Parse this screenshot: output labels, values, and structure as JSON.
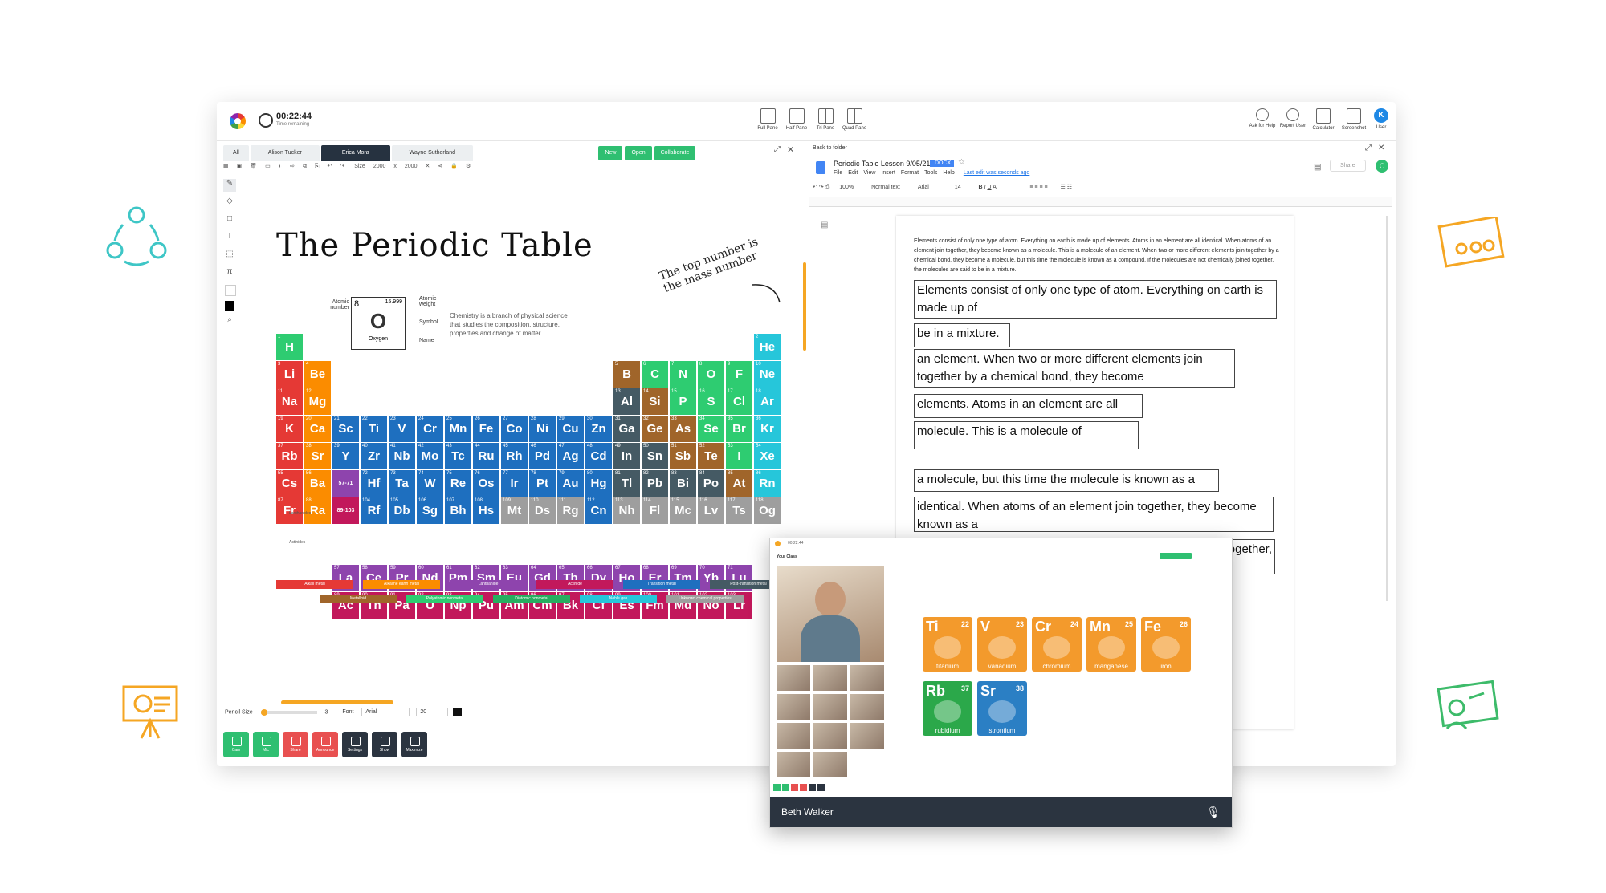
{
  "header": {
    "timer": "00:22:44",
    "timer_sub": "Time remaining",
    "panes": [
      "Full Pane",
      "Half Pane",
      "Tri Pane",
      "Quad Pane"
    ],
    "tools": [
      "Ask for Help",
      "Report User",
      "Calculator",
      "Screenshot"
    ],
    "user_initial": "K",
    "user_label": "User"
  },
  "tabs": [
    "All",
    "Alison Tucker",
    "Erica Mora",
    "Wayne Sutherland"
  ],
  "actions": {
    "new": "New",
    "open": "Open",
    "collaborate": "Collaborate"
  },
  "toolbar": {
    "size_label": "Size",
    "width": "2000",
    "x": "x",
    "height": "2000"
  },
  "whiteboard": {
    "title": "The Periodic Table",
    "note": "The top number is the mass number",
    "description": "Chemistry is a branch of physical science that studies the composition, structure, properties and change of matter",
    "key": {
      "number": "8",
      "weight": "15.999",
      "symbol": "O",
      "name": "Oxygen",
      "labels": [
        "Atomic number",
        "Atomic weight",
        "Symbol",
        "Name"
      ]
    },
    "lanthanides_label": "Lanthanides",
    "actinides_label": "Actinides"
  },
  "footer": {
    "pencil_label": "Pencil Size",
    "pencil_value": "3",
    "font_label": "Font",
    "font_value": "Arial",
    "font_size": "20",
    "buttons": [
      "Cam",
      "Mic",
      "Share",
      "Announce",
      "Settings",
      "Show",
      "Maximize"
    ]
  },
  "doc": {
    "back": "Back to folder",
    "title": "Periodic Table Lesson 9/05/21",
    "badge": ".DOCX",
    "menu": [
      "File",
      "Edit",
      "View",
      "Insert",
      "Format",
      "Tools",
      "Help"
    ],
    "last_edit": "Last edit was seconds ago",
    "share": "Share",
    "zoom": "100%",
    "style": "Normal text",
    "font": "Arial",
    "font_size": "14",
    "paragraph": "Elements consist of only one type of atom. Everything on earth is made up of elements. Atoms in an element are all identical. When atoms of an element join together, they become known as a molecule. This is a molecule of an element. When two or more different elements join together by a chemical bond, they become a molecule, but this time the molecule is known as a compound. If the molecules are not chemically joined together, the molecules are said to be in a mixture.",
    "strips": [
      "Elements consist of only one type of atom. Everything on earth is made up of",
      "be in a mixture.",
      "an element. When two or more different elements join together by a chemical bond, they become",
      "elements. Atoms in an element are all",
      "molecule. This is a molecule of",
      "a molecule, but this time the molecule is known as a",
      "identical. When atoms of an element join together, they become known as a",
      "together,"
    ]
  },
  "popup": {
    "name": "Beth Walker",
    "class_label": "Your Class",
    "tiles": [
      {
        "s": "Ti",
        "n": "22",
        "name": "titanium",
        "color": "#f39a2c"
      },
      {
        "s": "V",
        "n": "23",
        "name": "vanadium",
        "color": "#f39a2c"
      },
      {
        "s": "Cr",
        "n": "24",
        "name": "chromium",
        "color": "#f39a2c"
      },
      {
        "s": "Mn",
        "n": "25",
        "name": "manganese",
        "color": "#f39a2c"
      },
      {
        "s": "Fe",
        "n": "26",
        "name": "iron",
        "color": "#f39a2c"
      },
      {
        "s": "Rb",
        "n": "37",
        "name": "rubidium",
        "color": "#2ba84a"
      },
      {
        "s": "Sr",
        "n": "38",
        "name": "strontium",
        "color": "#2b7fc4"
      }
    ]
  },
  "legend": [
    {
      "label": "Alkali metal",
      "color": "#e53935"
    },
    {
      "label": "Alkaline earth metal",
      "color": "#fb8c00"
    },
    {
      "label": "Lanthanide",
      "color": "#8e44ad"
    },
    {
      "label": "Actinide",
      "color": "#c2185b"
    },
    {
      "label": "Transition metal",
      "color": "#1e6fbf"
    },
    {
      "label": "Post-transition metal",
      "color": "#455a64"
    },
    {
      "label": "Metalloid",
      "color": "#a0652a"
    },
    {
      "label": "Polyatomic nonmetal",
      "color": "#2ecc71"
    },
    {
      "label": "Diatomic nonmetal",
      "color": "#27ae60"
    },
    {
      "label": "Noble gas",
      "color": "#26c6da"
    },
    {
      "label": "Unknown chemical properties",
      "color": "#9e9e9e"
    }
  ],
  "elements": [
    {
      "s": "H",
      "n": 1,
      "r": 0,
      "c": 0,
      "g": "nm"
    },
    {
      "s": "He",
      "n": 2,
      "r": 0,
      "c": 17,
      "g": "ng"
    },
    {
      "s": "Li",
      "n": 3,
      "r": 1,
      "c": 0,
      "g": "am"
    },
    {
      "s": "Be",
      "n": 4,
      "r": 1,
      "c": 1,
      "g": "ae"
    },
    {
      "s": "B",
      "n": 5,
      "r": 1,
      "c": 12,
      "g": "ml"
    },
    {
      "s": "C",
      "n": 6,
      "r": 1,
      "c": 13,
      "g": "nm"
    },
    {
      "s": "N",
      "n": 7,
      "r": 1,
      "c": 14,
      "g": "nm"
    },
    {
      "s": "O",
      "n": 8,
      "r": 1,
      "c": 15,
      "g": "nm"
    },
    {
      "s": "F",
      "n": 9,
      "r": 1,
      "c": 16,
      "g": "nm"
    },
    {
      "s": "Ne",
      "n": 10,
      "r": 1,
      "c": 17,
      "g": "ng"
    },
    {
      "s": "Na",
      "n": 11,
      "r": 2,
      "c": 0,
      "g": "am"
    },
    {
      "s": "Mg",
      "n": 12,
      "r": 2,
      "c": 1,
      "g": "ae"
    },
    {
      "s": "Al",
      "n": 13,
      "r": 2,
      "c": 12,
      "g": "pt"
    },
    {
      "s": "Si",
      "n": 14,
      "r": 2,
      "c": 13,
      "g": "ml"
    },
    {
      "s": "P",
      "n": 15,
      "r": 2,
      "c": 14,
      "g": "nm"
    },
    {
      "s": "S",
      "n": 16,
      "r": 2,
      "c": 15,
      "g": "nm"
    },
    {
      "s": "Cl",
      "n": 17,
      "r": 2,
      "c": 16,
      "g": "nm"
    },
    {
      "s": "Ar",
      "n": 18,
      "r": 2,
      "c": 17,
      "g": "ng"
    },
    {
      "s": "K",
      "n": 19,
      "r": 3,
      "c": 0,
      "g": "am"
    },
    {
      "s": "Ca",
      "n": 20,
      "r": 3,
      "c": 1,
      "g": "ae"
    },
    {
      "s": "Sc",
      "n": 21,
      "r": 3,
      "c": 2,
      "g": "tm"
    },
    {
      "s": "Ti",
      "n": 22,
      "r": 3,
      "c": 3,
      "g": "tm"
    },
    {
      "s": "V",
      "n": 23,
      "r": 3,
      "c": 4,
      "g": "tm"
    },
    {
      "s": "Cr",
      "n": 24,
      "r": 3,
      "c": 5,
      "g": "tm"
    },
    {
      "s": "Mn",
      "n": 25,
      "r": 3,
      "c": 6,
      "g": "tm"
    },
    {
      "s": "Fe",
      "n": 26,
      "r": 3,
      "c": 7,
      "g": "tm"
    },
    {
      "s": "Co",
      "n": 27,
      "r": 3,
      "c": 8,
      "g": "tm"
    },
    {
      "s": "Ni",
      "n": 28,
      "r": 3,
      "c": 9,
      "g": "tm"
    },
    {
      "s": "Cu",
      "n": 29,
      "r": 3,
      "c": 10,
      "g": "tm"
    },
    {
      "s": "Zn",
      "n": 30,
      "r": 3,
      "c": 11,
      "g": "tm"
    },
    {
      "s": "Ga",
      "n": 31,
      "r": 3,
      "c": 12,
      "g": "pt"
    },
    {
      "s": "Ge",
      "n": 32,
      "r": 3,
      "c": 13,
      "g": "ml"
    },
    {
      "s": "As",
      "n": 33,
      "r": 3,
      "c": 14,
      "g": "ml"
    },
    {
      "s": "Se",
      "n": 34,
      "r": 3,
      "c": 15,
      "g": "nm"
    },
    {
      "s": "Br",
      "n": 35,
      "r": 3,
      "c": 16,
      "g": "nm"
    },
    {
      "s": "Kr",
      "n": 36,
      "r": 3,
      "c": 17,
      "g": "ng"
    },
    {
      "s": "Rb",
      "n": 37,
      "r": 4,
      "c": 0,
      "g": "am"
    },
    {
      "s": "Sr",
      "n": 38,
      "r": 4,
      "c": 1,
      "g": "ae"
    },
    {
      "s": "Y",
      "n": 39,
      "r": 4,
      "c": 2,
      "g": "tm"
    },
    {
      "s": "Zr",
      "n": 40,
      "r": 4,
      "c": 3,
      "g": "tm"
    },
    {
      "s": "Nb",
      "n": 41,
      "r": 4,
      "c": 4,
      "g": "tm"
    },
    {
      "s": "Mo",
      "n": 42,
      "r": 4,
      "c": 5,
      "g": "tm"
    },
    {
      "s": "Tc",
      "n": 43,
      "r": 4,
      "c": 6,
      "g": "tm"
    },
    {
      "s": "Ru",
      "n": 44,
      "r": 4,
      "c": 7,
      "g": "tm"
    },
    {
      "s": "Rh",
      "n": 45,
      "r": 4,
      "c": 8,
      "g": "tm"
    },
    {
      "s": "Pd",
      "n": 46,
      "r": 4,
      "c": 9,
      "g": "tm"
    },
    {
      "s": "Ag",
      "n": 47,
      "r": 4,
      "c": 10,
      "g": "tm"
    },
    {
      "s": "Cd",
      "n": 48,
      "r": 4,
      "c": 11,
      "g": "tm"
    },
    {
      "s": "In",
      "n": 49,
      "r": 4,
      "c": 12,
      "g": "pt"
    },
    {
      "s": "Sn",
      "n": 50,
      "r": 4,
      "c": 13,
      "g": "pt"
    },
    {
      "s": "Sb",
      "n": 51,
      "r": 4,
      "c": 14,
      "g": "ml"
    },
    {
      "s": "Te",
      "n": 52,
      "r": 4,
      "c": 15,
      "g": "ml"
    },
    {
      "s": "I",
      "n": 53,
      "r": 4,
      "c": 16,
      "g": "nm"
    },
    {
      "s": "Xe",
      "n": 54,
      "r": 4,
      "c": 17,
      "g": "ng"
    },
    {
      "s": "Cs",
      "n": 55,
      "r": 5,
      "c": 0,
      "g": "am"
    },
    {
      "s": "Ba",
      "n": 56,
      "r": 5,
      "c": 1,
      "g": "ae"
    },
    {
      "s": "57-71",
      "n": "",
      "r": 5,
      "c": 2,
      "g": "la"
    },
    {
      "s": "Hf",
      "n": 72,
      "r": 5,
      "c": 3,
      "g": "tm"
    },
    {
      "s": "Ta",
      "n": 73,
      "r": 5,
      "c": 4,
      "g": "tm"
    },
    {
      "s": "W",
      "n": 74,
      "r": 5,
      "c": 5,
      "g": "tm"
    },
    {
      "s": "Re",
      "n": 75,
      "r": 5,
      "c": 6,
      "g": "tm"
    },
    {
      "s": "Os",
      "n": 76,
      "r": 5,
      "c": 7,
      "g": "tm"
    },
    {
      "s": "Ir",
      "n": 77,
      "r": 5,
      "c": 8,
      "g": "tm"
    },
    {
      "s": "Pt",
      "n": 78,
      "r": 5,
      "c": 9,
      "g": "tm"
    },
    {
      "s": "Au",
      "n": 79,
      "r": 5,
      "c": 10,
      "g": "tm"
    },
    {
      "s": "Hg",
      "n": 80,
      "r": 5,
      "c": 11,
      "g": "tm"
    },
    {
      "s": "Tl",
      "n": 81,
      "r": 5,
      "c": 12,
      "g": "pt"
    },
    {
      "s": "Pb",
      "n": 82,
      "r": 5,
      "c": 13,
      "g": "pt"
    },
    {
      "s": "Bi",
      "n": 83,
      "r": 5,
      "c": 14,
      "g": "pt"
    },
    {
      "s": "Po",
      "n": 84,
      "r": 5,
      "c": 15,
      "g": "pt"
    },
    {
      "s": "At",
      "n": 85,
      "r": 5,
      "c": 16,
      "g": "ml"
    },
    {
      "s": "Rn",
      "n": 86,
      "r": 5,
      "c": 17,
      "g": "ng"
    },
    {
      "s": "Fr",
      "n": 87,
      "r": 6,
      "c": 0,
      "g": "am"
    },
    {
      "s": "Ra",
      "n": 88,
      "r": 6,
      "c": 1,
      "g": "ae"
    },
    {
      "s": "89-103",
      "n": "",
      "r": 6,
      "c": 2,
      "g": "ac"
    },
    {
      "s": "Rf",
      "n": 104,
      "r": 6,
      "c": 3,
      "g": "tm"
    },
    {
      "s": "Db",
      "n": 105,
      "r": 6,
      "c": 4,
      "g": "tm"
    },
    {
      "s": "Sg",
      "n": 106,
      "r": 6,
      "c": 5,
      "g": "tm"
    },
    {
      "s": "Bh",
      "n": 107,
      "r": 6,
      "c": 6,
      "g": "tm"
    },
    {
      "s": "Hs",
      "n": 108,
      "r": 6,
      "c": 7,
      "g": "tm"
    },
    {
      "s": "Mt",
      "n": 109,
      "r": 6,
      "c": 8,
      "g": "uk"
    },
    {
      "s": "Ds",
      "n": 110,
      "r": 6,
      "c": 9,
      "g": "uk"
    },
    {
      "s": "Rg",
      "n": 111,
      "r": 6,
      "c": 10,
      "g": "uk"
    },
    {
      "s": "Cn",
      "n": 112,
      "r": 6,
      "c": 11,
      "g": "tm"
    },
    {
      "s": "Nh",
      "n": 113,
      "r": 6,
      "c": 12,
      "g": "uk"
    },
    {
      "s": "Fl",
      "n": 114,
      "r": 6,
      "c": 13,
      "g": "uk"
    },
    {
      "s": "Mc",
      "n": 115,
      "r": 6,
      "c": 14,
      "g": "uk"
    },
    {
      "s": "Lv",
      "n": 116,
      "r": 6,
      "c": 15,
      "g": "uk"
    },
    {
      "s": "Ts",
      "n": 117,
      "r": 6,
      "c": 16,
      "g": "uk"
    },
    {
      "s": "Og",
      "n": 118,
      "r": 6,
      "c": 17,
      "g": "uk"
    },
    {
      "s": "La",
      "n": 57,
      "r": 8,
      "c": 2,
      "g": "la"
    },
    {
      "s": "Ce",
      "n": 58,
      "r": 8,
      "c": 3,
      "g": "la"
    },
    {
      "s": "Pr",
      "n": 59,
      "r": 8,
      "c": 4,
      "g": "la"
    },
    {
      "s": "Nd",
      "n": 60,
      "r": 8,
      "c": 5,
      "g": "la"
    },
    {
      "s": "Pm",
      "n": 61,
      "r": 8,
      "c": 6,
      "g": "la"
    },
    {
      "s": "Sm",
      "n": 62,
      "r": 8,
      "c": 7,
      "g": "la"
    },
    {
      "s": "Eu",
      "n": 63,
      "r": 8,
      "c": 8,
      "g": "la"
    },
    {
      "s": "Gd",
      "n": 64,
      "r": 8,
      "c": 9,
      "g": "la"
    },
    {
      "s": "Tb",
      "n": 65,
      "r": 8,
      "c": 10,
      "g": "la"
    },
    {
      "s": "Dy",
      "n": 66,
      "r": 8,
      "c": 11,
      "g": "la"
    },
    {
      "s": "Ho",
      "n": 67,
      "r": 8,
      "c": 12,
      "g": "la"
    },
    {
      "s": "Er",
      "n": 68,
      "r": 8,
      "c": 13,
      "g": "la"
    },
    {
      "s": "Tm",
      "n": 69,
      "r": 8,
      "c": 14,
      "g": "la"
    },
    {
      "s": "Yb",
      "n": 70,
      "r": 8,
      "c": 15,
      "g": "la"
    },
    {
      "s": "Lu",
      "n": 71,
      "r": 8,
      "c": 16,
      "g": "la"
    },
    {
      "s": "Ac",
      "n": 89,
      "r": 9,
      "c": 2,
      "g": "ac"
    },
    {
      "s": "Th",
      "n": 90,
      "r": 9,
      "c": 3,
      "g": "ac"
    },
    {
      "s": "Pa",
      "n": 91,
      "r": 9,
      "c": 4,
      "g": "ac"
    },
    {
      "s": "U",
      "n": 92,
      "r": 9,
      "c": 5,
      "g": "ac"
    },
    {
      "s": "Np",
      "n": 93,
      "r": 9,
      "c": 6,
      "g": "ac"
    },
    {
      "s": "Pu",
      "n": 94,
      "r": 9,
      "c": 7,
      "g": "ac"
    },
    {
      "s": "Am",
      "n": 95,
      "r": 9,
      "c": 8,
      "g": "ac"
    },
    {
      "s": "Cm",
      "n": 96,
      "r": 9,
      "c": 9,
      "g": "ac"
    },
    {
      "s": "Bk",
      "n": 97,
      "r": 9,
      "c": 10,
      "g": "ac"
    },
    {
      "s": "Cf",
      "n": 98,
      "r": 9,
      "c": 11,
      "g": "ac"
    },
    {
      "s": "Es",
      "n": 99,
      "r": 9,
      "c": 12,
      "g": "ac"
    },
    {
      "s": "Fm",
      "n": 100,
      "r": 9,
      "c": 13,
      "g": "ac"
    },
    {
      "s": "Md",
      "n": 101,
      "r": 9,
      "c": 14,
      "g": "ac"
    },
    {
      "s": "No",
      "n": 102,
      "r": 9,
      "c": 15,
      "g": "ac"
    },
    {
      "s": "Lr",
      "n": 103,
      "r": 9,
      "c": 16,
      "g": "ac"
    }
  ],
  "group_colors": {
    "am": "#e53935",
    "ae": "#fb8c00",
    "tm": "#1e6fbf",
    "pt": "#455a64",
    "ml": "#a0652a",
    "nm": "#2ecc71",
    "ng": "#26c6da",
    "la": "#8e44ad",
    "ac": "#c2185b",
    "uk": "#9e9e9e"
  }
}
